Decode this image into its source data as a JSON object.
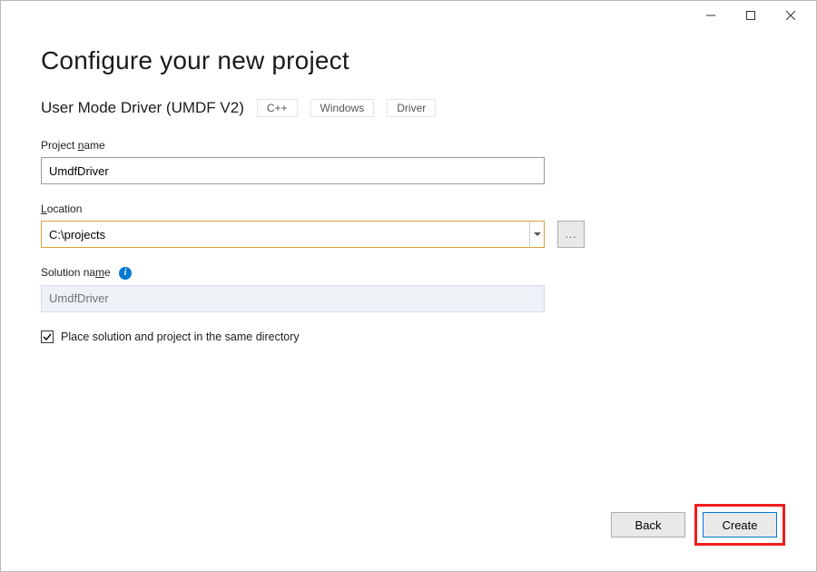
{
  "title": "Configure your new project",
  "template": {
    "name": "User Mode Driver (UMDF V2)",
    "tags": [
      "C++",
      "Windows",
      "Driver"
    ]
  },
  "fields": {
    "project_name": {
      "label_pre": "Project ",
      "label_accel": "n",
      "label_post": "ame",
      "value": "UmdfDriver"
    },
    "location": {
      "label_accel": "L",
      "label_post": "ocation",
      "value": "C:\\projects",
      "browse_label": "..."
    },
    "solution_name": {
      "label_pre": "Solution na",
      "label_accel": "m",
      "label_post": "e",
      "placeholder": "UmdfDriver"
    },
    "same_dir": {
      "checked": true,
      "label_pre": "Place solution and project in the same ",
      "label_accel": "d",
      "label_post": "irectory"
    }
  },
  "buttons": {
    "back_accel": "B",
    "back_post": "ack",
    "create_accel": "C",
    "create_post": "reate"
  }
}
